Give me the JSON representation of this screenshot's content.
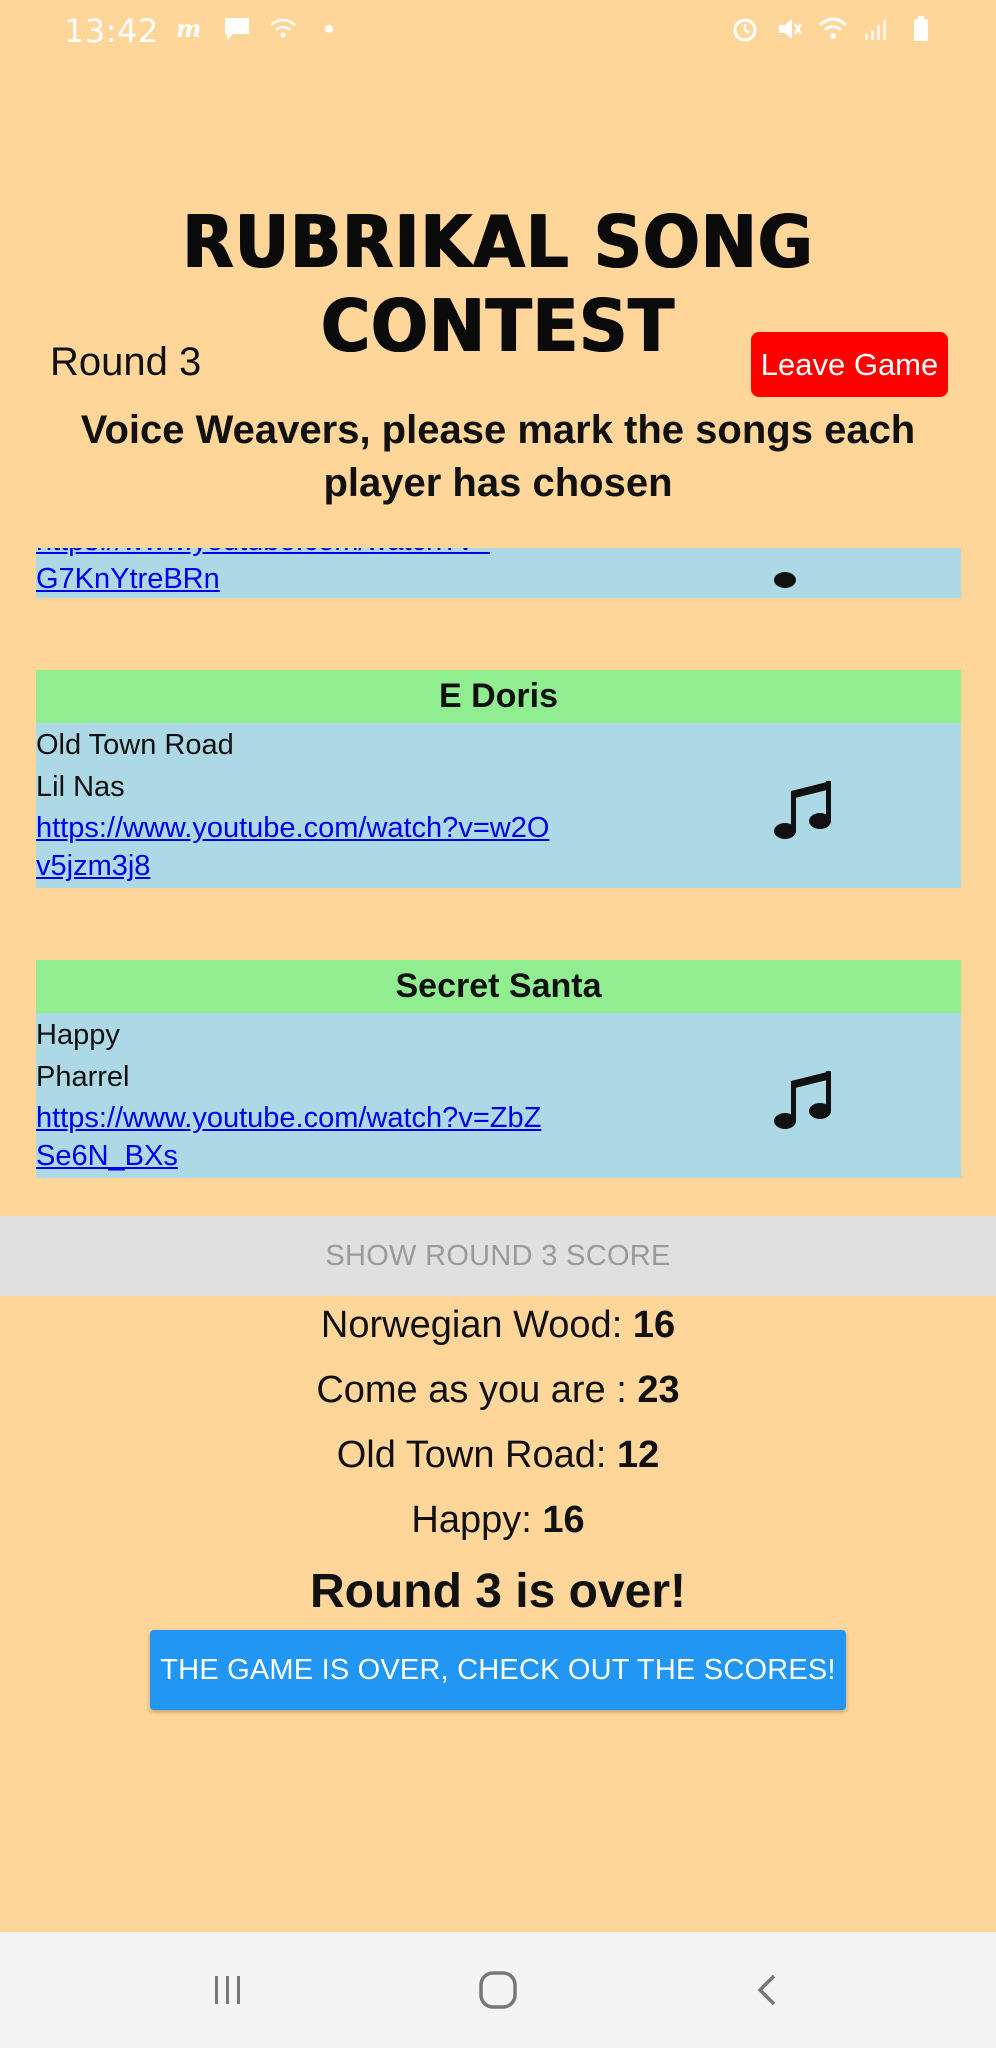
{
  "status_bar": {
    "time": "13:42"
  },
  "app": {
    "title": "RUBRIKAL SONG CONTEST",
    "round_label": "Round 3",
    "leave_button": "Leave Game",
    "instruction": "Voice Weavers, please mark the songs each player has chosen"
  },
  "partial_card": {
    "link_line1": "https://www.youtube.com/watch?v=",
    "link_line2": "G7KnYtreBRn"
  },
  "songs": [
    {
      "player": "E Doris",
      "title": "Old Town Road",
      "artist": "Lil Nas",
      "link": "https://www.youtube.com/watch?v=w2Ov5jzm3j8"
    },
    {
      "player": "Secret Santa",
      "title": "Happy",
      "artist": "Pharrel",
      "link": "https://www.youtube.com/watch?v=ZbZSe6N_BXs"
    }
  ],
  "score_section": {
    "show_score_button": "SHOW ROUND 3 SCORE",
    "scores": [
      {
        "label": "Norwegian Wood: ",
        "value": "16"
      },
      {
        "label": "Come as you are : ",
        "value": "23"
      },
      {
        "label": "Old Town Road: ",
        "value": "12"
      },
      {
        "label": "Happy: ",
        "value": "16"
      }
    ],
    "round_over": "Round 3 is over!",
    "final_button": "THE GAME IS OVER, CHECK OUT THE SCORES!"
  },
  "colors": {
    "background": "#FED69A",
    "card_header": "#90EE90",
    "card_body": "#ADD8E6",
    "leave_button": "#FF0000",
    "final_button": "#2196F3"
  },
  "icons": {
    "song_icon": "music-note-icon"
  }
}
